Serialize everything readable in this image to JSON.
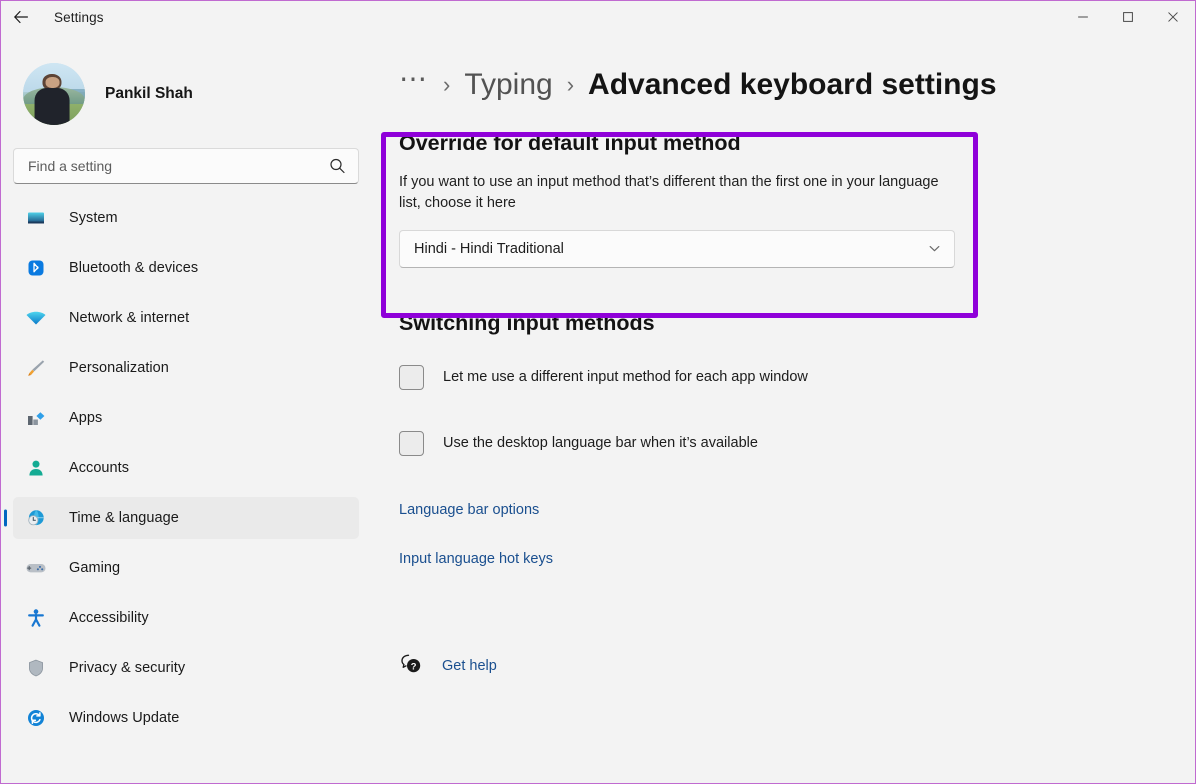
{
  "window": {
    "title": "Settings",
    "back_icon": "back-arrow-icon",
    "minimize_label": "Minimize",
    "maximize_label": "Maximize",
    "close_label": "Close"
  },
  "sidebar": {
    "profile": {
      "name": "Pankil Shah",
      "avatar_icon": "user-avatar"
    },
    "search": {
      "placeholder": "Find a setting",
      "value": "",
      "icon": "search-icon"
    },
    "items": [
      {
        "label": "System",
        "icon": "system-monitor-icon",
        "active": false
      },
      {
        "label": "Bluetooth & devices",
        "icon": "bluetooth-icon",
        "active": false
      },
      {
        "label": "Network & internet",
        "icon": "wifi-icon",
        "active": false
      },
      {
        "label": "Personalization",
        "icon": "paintbrush-icon",
        "active": false
      },
      {
        "label": "Apps",
        "icon": "apps-icon",
        "active": false
      },
      {
        "label": "Accounts",
        "icon": "person-icon",
        "active": false
      },
      {
        "label": "Time & language",
        "icon": "globe-clock-icon",
        "active": true
      },
      {
        "label": "Gaming",
        "icon": "gamepad-icon",
        "active": false
      },
      {
        "label": "Accessibility",
        "icon": "accessibility-icon",
        "active": false
      },
      {
        "label": "Privacy & security",
        "icon": "shield-icon",
        "active": false
      },
      {
        "label": "Windows Update",
        "icon": "update-refresh-icon",
        "active": false
      }
    ]
  },
  "breadcrumb": {
    "overflow": "⋯",
    "separator": "›",
    "parent": "Typing",
    "current": "Advanced keyboard settings"
  },
  "main": {
    "override_section": {
      "title": "Override for default input method",
      "description": "If you want to use an input method that’s different than the first one in your language list, choose it here",
      "dropdown_value": "Hindi - Hindi Traditional",
      "dropdown_icon": "chevron-down-icon",
      "highlight_color": "#8f00d9"
    },
    "switching_section": {
      "title": "Switching input methods",
      "checkboxes": [
        {
          "label": "Let me use a different input method for each app window",
          "checked": false
        },
        {
          "label": "Use the desktop language bar when it’s available",
          "checked": false
        }
      ],
      "links": [
        "Language bar options",
        "Input language hot keys"
      ]
    },
    "get_help": {
      "label": "Get help",
      "icon": "help-question-icon"
    }
  },
  "colors": {
    "accent": "#0067c0",
    "link": "#1a4f8f",
    "highlight": "#8f00d9",
    "background": "#f3f3f3"
  }
}
